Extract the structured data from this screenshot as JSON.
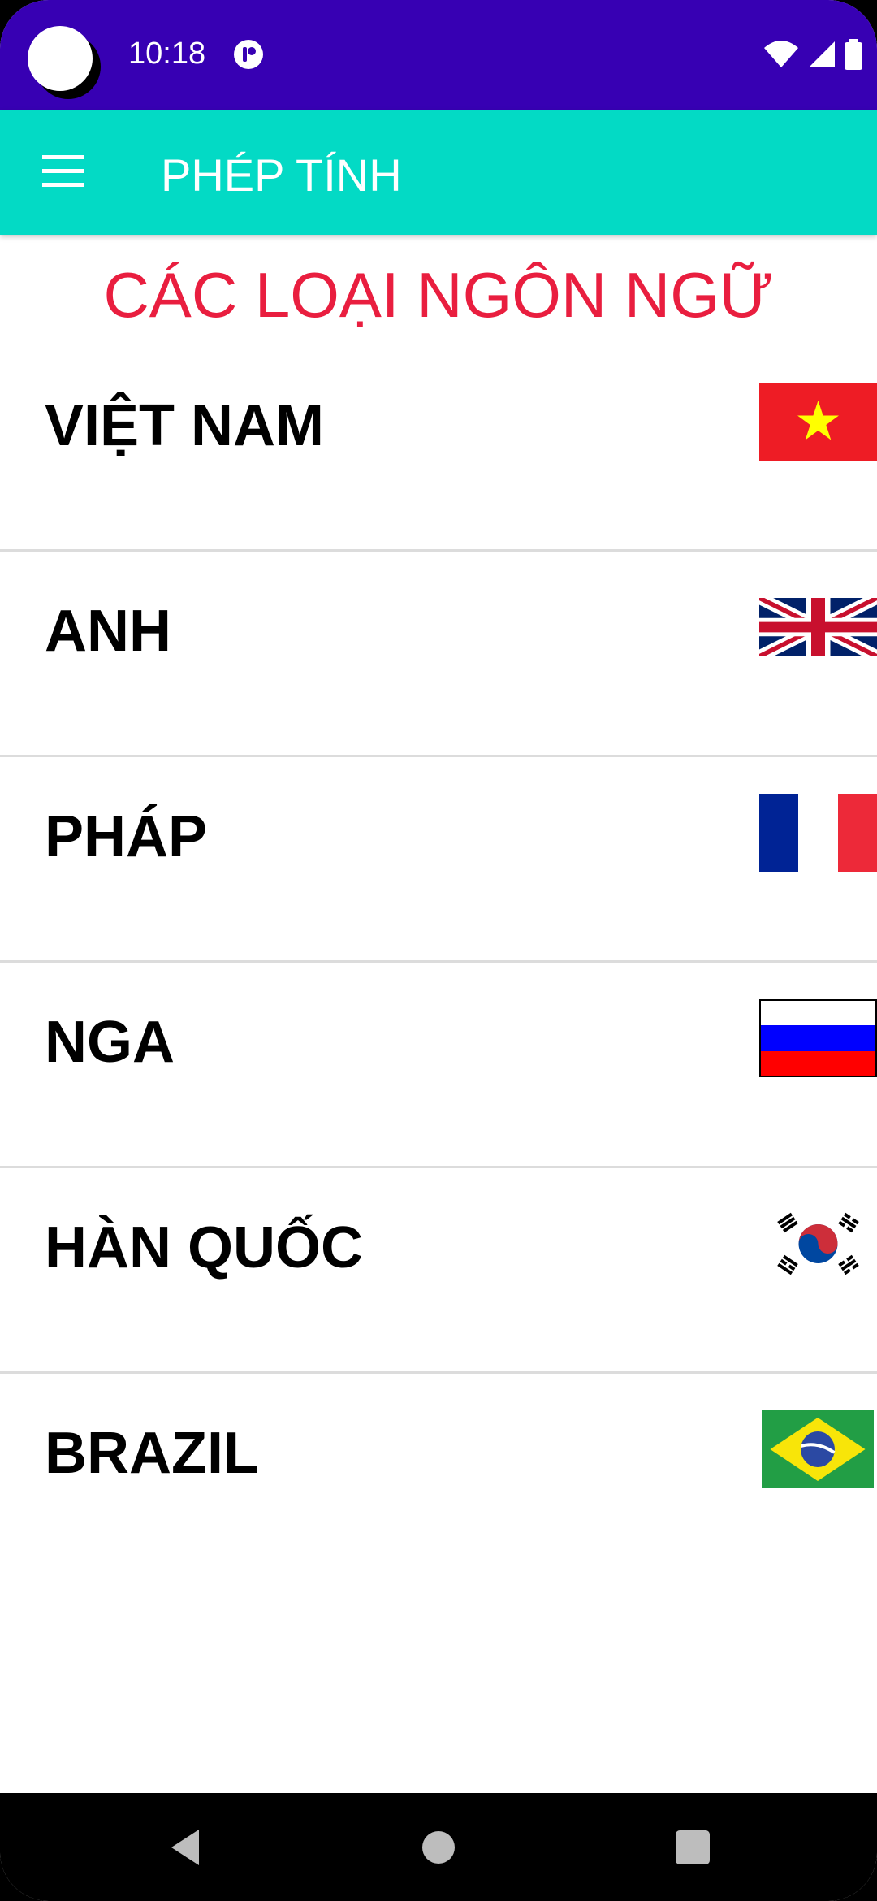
{
  "status_bar": {
    "time": "10:18",
    "icons": [
      "avatar-icon",
      "app-notification-icon",
      "wifi-icon",
      "signal-icon",
      "battery-icon"
    ]
  },
  "app_bar": {
    "title": "PHÉP TÍNH",
    "menu_icon": "hamburger-menu-icon",
    "background": "#03DAC5"
  },
  "heading": "CÁC LOẠI NGÔN NGỮ",
  "colors": {
    "status_bar": "#3700B3",
    "heading": "#E91E3F"
  },
  "languages": [
    {
      "label": "VIỆT NAM",
      "flag": "vietnam-flag-icon"
    },
    {
      "label": "ANH",
      "flag": "uk-flag-icon"
    },
    {
      "label": "PHÁP",
      "flag": "france-flag-icon"
    },
    {
      "label": "NGA",
      "flag": "russia-flag-icon"
    },
    {
      "label": "HÀN QUỐC",
      "flag": "south-korea-flag-icon"
    },
    {
      "label": "BRAZIL",
      "flag": "brazil-flag-icon"
    }
  ],
  "nav_bar": {
    "buttons": [
      "back-icon",
      "home-icon",
      "recents-icon"
    ]
  }
}
